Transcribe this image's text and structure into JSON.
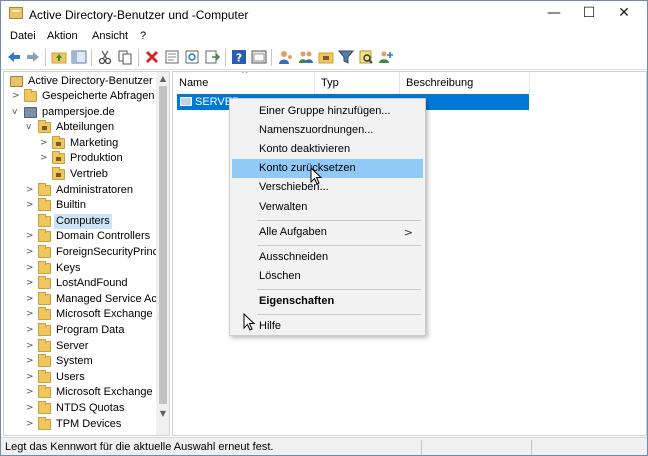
{
  "window": {
    "title": "Active Directory-Benutzer und -Computer",
    "controls": {
      "minimize": "—",
      "maximize": "☐",
      "close": "✕"
    }
  },
  "menubar": [
    "Datei",
    "Aktion",
    "Ansicht",
    "?"
  ],
  "tree": {
    "root": "Active Directory-Benutzer un",
    "items": [
      {
        "label": "Gespeicherte Abfragen",
        "level": 1,
        "twisty": ">"
      },
      {
        "label": "pampersjoe.de",
        "level": 1,
        "twisty": "v"
      },
      {
        "label": "Abteilungen",
        "level": 2,
        "twisty": "v"
      },
      {
        "label": "Marketing",
        "level": 3,
        "twisty": ">"
      },
      {
        "label": "Produktion",
        "level": 3,
        "twisty": ">"
      },
      {
        "label": "Vertrieb",
        "level": 3,
        "twisty": ""
      },
      {
        "label": "Administratoren",
        "level": 2,
        "twisty": ">"
      },
      {
        "label": "Builtin",
        "level": 2,
        "twisty": ">"
      },
      {
        "label": "Computers",
        "level": 2,
        "twisty": "",
        "selected": true
      },
      {
        "label": "Domain Controllers",
        "level": 2,
        "twisty": ">"
      },
      {
        "label": "ForeignSecurityPrinci",
        "level": 2,
        "twisty": ">"
      },
      {
        "label": "Keys",
        "level": 2,
        "twisty": ">"
      },
      {
        "label": "LostAndFound",
        "level": 2,
        "twisty": ">"
      },
      {
        "label": "Managed Service Acc",
        "level": 2,
        "twisty": ">"
      },
      {
        "label": "Microsoft Exchange S",
        "level": 2,
        "twisty": ">"
      },
      {
        "label": "Program Data",
        "level": 2,
        "twisty": ">"
      },
      {
        "label": "Server",
        "level": 2,
        "twisty": ">"
      },
      {
        "label": "System",
        "level": 2,
        "twisty": ">"
      },
      {
        "label": "Users",
        "level": 2,
        "twisty": ">"
      },
      {
        "label": "Microsoft Exchange S",
        "level": 2,
        "twisty": ">"
      },
      {
        "label": "NTDS Quotas",
        "level": 2,
        "twisty": ">"
      },
      {
        "label": "TPM Devices",
        "level": 2,
        "twisty": ">"
      }
    ]
  },
  "list": {
    "columns": [
      "Name",
      "Typ",
      "Beschreibung"
    ],
    "sort_indicator": "^",
    "rows": [
      {
        "name": "SERVER"
      }
    ]
  },
  "context_menu": {
    "items": [
      {
        "label": "Einer Gruppe hinzufügen..."
      },
      {
        "label": "Namenszuordnungen..."
      },
      {
        "label": "Konto deaktivieren"
      },
      {
        "label": "Konto zurücksetzen",
        "hover": true
      },
      {
        "label": "Verschieben..."
      },
      {
        "label": "Verwalten"
      },
      {
        "separator": true
      },
      {
        "label": "Alle Aufgaben",
        "submenu": ">"
      },
      {
        "separator": true
      },
      {
        "label": "Ausschneiden"
      },
      {
        "label": "Löschen"
      },
      {
        "separator": true
      },
      {
        "label": "Eigenschaften",
        "bold": true
      },
      {
        "separator": true
      },
      {
        "label": "Hilfe"
      }
    ]
  },
  "statusbar": {
    "text": "Legt das Kennwort für die aktuelle Auswahl erneut fest."
  },
  "colors": {
    "selection": "#0078d7",
    "menu_hover": "#91c9f7",
    "menu_bg": "#f2f2f2",
    "tree_selected": "#cce4f7"
  },
  "toolbar_icons": [
    "back-arrow-icon",
    "forward-arrow-icon",
    "up-folder-icon",
    "show-tree-icon",
    "cut-icon",
    "copy-icon",
    "delete-icon",
    "properties-icon",
    "refresh-icon",
    "export-icon",
    "help-icon",
    "console-icon",
    "users-icon",
    "group-icon",
    "ou-icon",
    "filter-icon",
    "find-icon",
    "add-to-group-icon"
  ]
}
